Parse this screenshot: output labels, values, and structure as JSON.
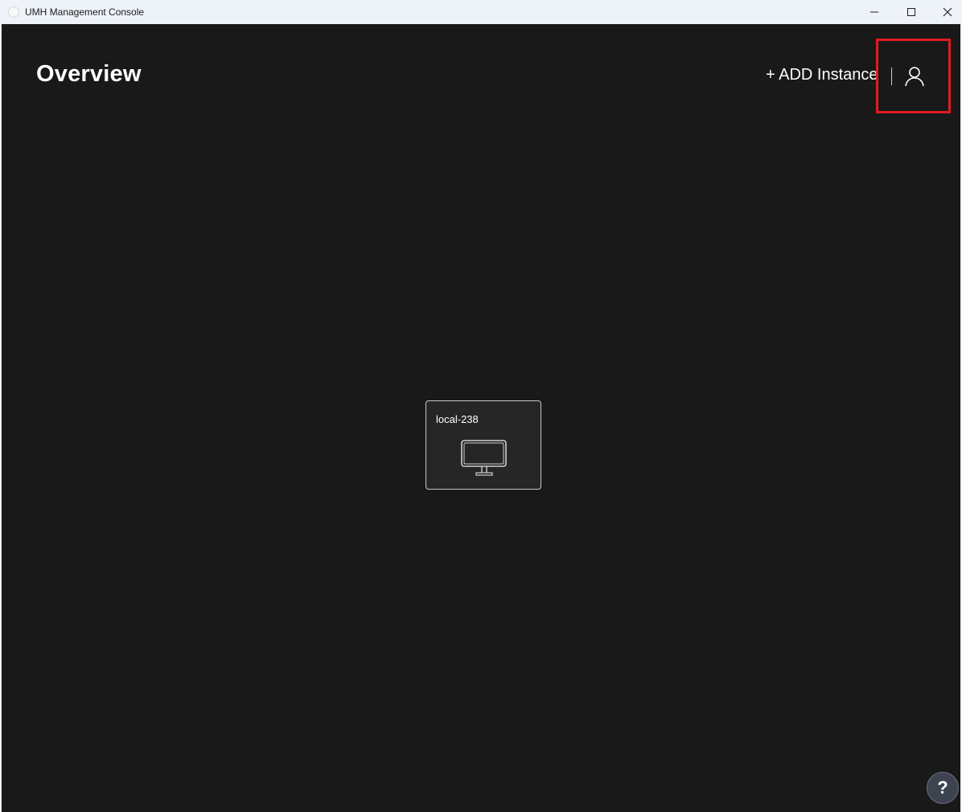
{
  "window": {
    "title": "UMH Management Console"
  },
  "header": {
    "title": "Overview",
    "add_instance_label": "+ ADD Instance"
  },
  "instances": [
    {
      "name": "local-238",
      "icon": "monitor-icon"
    }
  ],
  "help": {
    "label": "?"
  },
  "colors": {
    "background": "#191919",
    "card_background": "#262626",
    "highlight": "#e11b22",
    "titlebar": "#eef2f9"
  }
}
